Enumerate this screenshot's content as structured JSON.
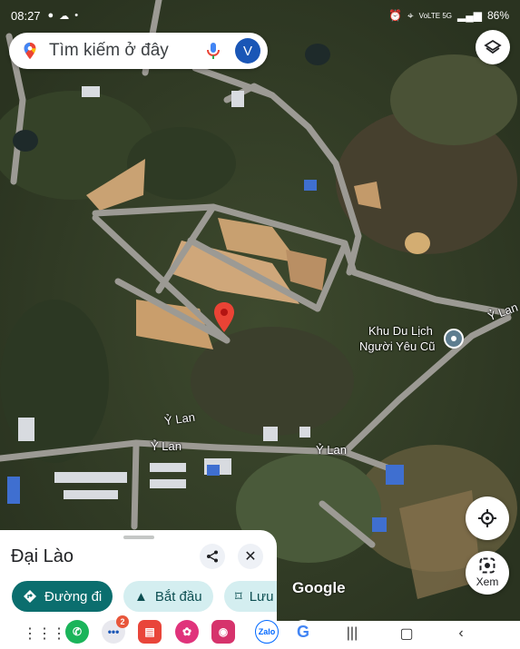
{
  "status_bar": {
    "time": "08:27",
    "network": "VoLTE 5G",
    "battery": "86%"
  },
  "search": {
    "placeholder": "Tìm kiếm ở đây",
    "avatar_letter": "V"
  },
  "map_labels": {
    "poi_line1": "Khu Du Lịch",
    "poi_line2": "Người Yêu Cũ",
    "road_1": "Ỷ Lan",
    "road_2": "Ỷ Lan",
    "road_3": "Ỷ Lan",
    "google": "Google"
  },
  "sheet": {
    "title": "Đại Lào",
    "close": "✕",
    "chips": {
      "directions": "Đường đi",
      "start": "Bắt đầu",
      "save": "Lưu"
    }
  },
  "fab": {
    "street_view_label": "Xem"
  },
  "app_badge": "2",
  "colors": {
    "accent": "#0b6e6e",
    "chip_bg": "#d4eef0",
    "pin": "#ea4335",
    "avatar": "#1a56b6"
  }
}
